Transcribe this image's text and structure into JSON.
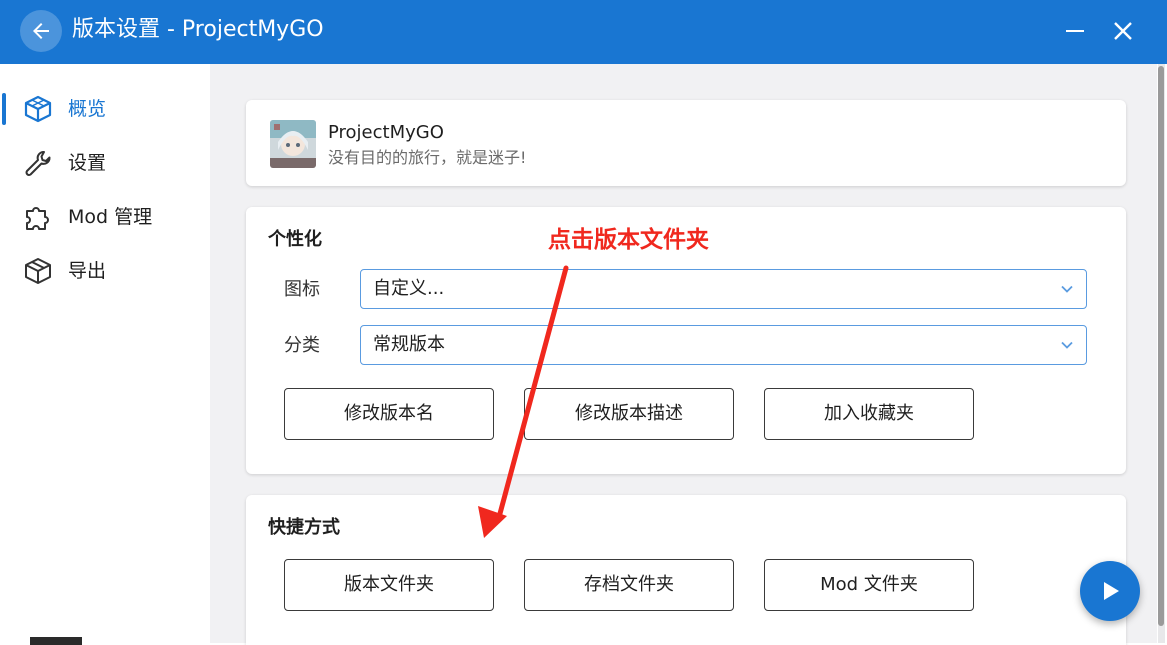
{
  "window": {
    "title": "版本设置 - ProjectMyGO",
    "back_icon": "arrow-left-icon",
    "minimize_icon": "minimize-icon",
    "close_icon": "close-icon"
  },
  "sidebar": {
    "items": [
      {
        "label": "概览",
        "icon": "cube-outline-icon",
        "active": true
      },
      {
        "label": "设置",
        "icon": "wrench-icon",
        "active": false
      },
      {
        "label": "Mod 管理",
        "icon": "puzzle-icon",
        "active": false
      },
      {
        "label": "导出",
        "icon": "package-icon",
        "active": false
      }
    ]
  },
  "info": {
    "name": "ProjectMyGO",
    "description": "没有目的的旅行，就是迷子!"
  },
  "personalization": {
    "title": "个性化",
    "icon_label": "图标",
    "icon_value": "自定义...",
    "category_label": "分类",
    "category_value": "常规版本",
    "buttons": [
      "修改版本名",
      "修改版本描述",
      "加入收藏夹"
    ]
  },
  "shortcuts": {
    "title": "快捷方式",
    "buttons": [
      "版本文件夹",
      "存档文件夹",
      "Mod 文件夹"
    ]
  },
  "annotation": {
    "text": "点击版本文件夹",
    "color": "#f0281e"
  },
  "fab": {
    "icon": "play-icon"
  },
  "colors": {
    "accent": "#1976d2",
    "background": "#f1f1f3"
  }
}
